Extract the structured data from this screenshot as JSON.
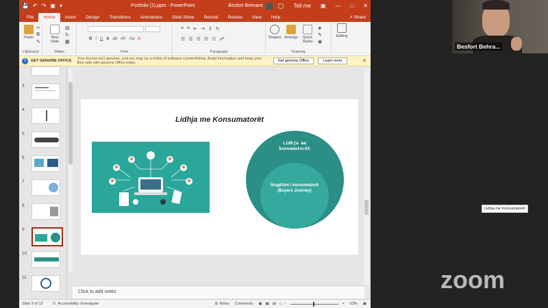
{
  "titlebar": {
    "file_title": "Portfolio (1).pptx",
    "separator": "-",
    "app_name": "PowerPoint",
    "user_name": "Besfort Behrami",
    "tell_me": "Tell me"
  },
  "tabs": [
    "File",
    "Home",
    "Insert",
    "Design",
    "Transitions",
    "Animations",
    "Slide Show",
    "Record",
    "Review",
    "View",
    "Help"
  ],
  "share_label": "Share",
  "ribbon": {
    "paste": "Paste",
    "new_slide": "New Slide",
    "shapes": "Shapes",
    "arrange": "Arrange",
    "quick_styles": "Quick Styles",
    "editing": "Editing",
    "groups": [
      "Clipboard",
      "Slides",
      "Font",
      "Paragraph",
      "Drawing"
    ],
    "font_buttons": [
      "B",
      "I",
      "U",
      "S",
      "ab",
      "AV",
      "Aa",
      "A"
    ]
  },
  "infobar": {
    "heading": "GET GENUINE OFFICE",
    "message": "Your license isn't genuine, and you may be a victim of software counterfeiting. Avoid interruption and keep your files safe with genuine Office today.",
    "btn_genuine": "Get genuine Office",
    "btn_learn": "Learn more"
  },
  "thumbnails": [
    "3",
    "4",
    "5",
    "6",
    "7",
    "8",
    "9",
    "10",
    "11"
  ],
  "selected_thumbnail": "9",
  "slide": {
    "title": "Lidhja me Konsumatorët",
    "outer_circle_text": "Lidhja me konsumatorët",
    "inner_circle_text": "Itrugëtimi i konsumatorit (Buyers Journey)"
  },
  "notes_placeholder": "Click to add notes",
  "status": {
    "slide_info": "Slide 9 of 12",
    "accessibility": "Accessibility: Investigate",
    "notes": "Notes",
    "comments": "Comments",
    "zoom": "63%"
  },
  "participant": {
    "name": "Besfort Behra..."
  },
  "tooltip": "Lidhja me Konsumatorët",
  "zoom_brand": "zoom",
  "colors": {
    "ppt_red": "#c43e1c",
    "teal_dark": "#2b8f86",
    "teal_light": "#36a99e",
    "illus_bg": "#2aa69a"
  }
}
